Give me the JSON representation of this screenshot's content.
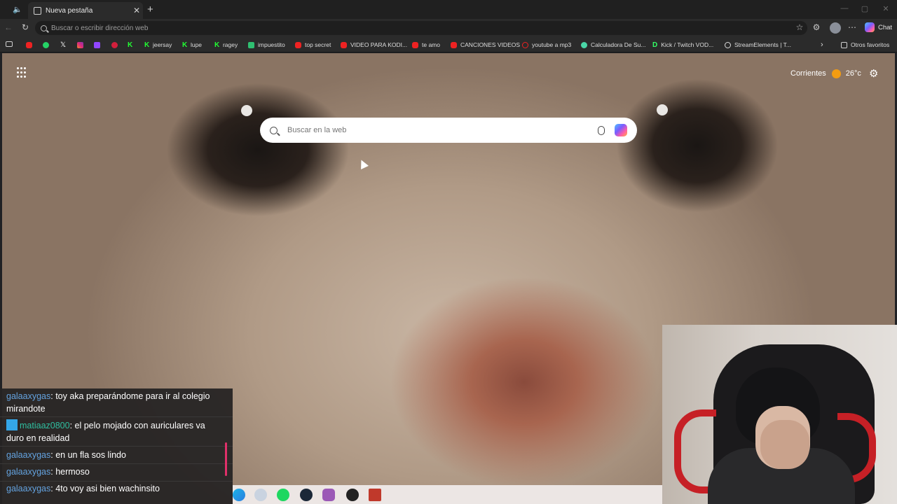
{
  "browser": {
    "tab_title": "Nueva pestaña",
    "address_placeholder": "Buscar o escribir dirección web",
    "chat_label": "Chat"
  },
  "bookmarks": [
    {
      "label": "",
      "icon": "youtube-icon"
    },
    {
      "label": "",
      "icon": "whatsapp-icon"
    },
    {
      "label": "",
      "icon": "x-icon"
    },
    {
      "label": "",
      "icon": "instagram-icon"
    },
    {
      "label": "",
      "icon": "twitch-icon"
    },
    {
      "label": "",
      "icon": "red-app-icon"
    },
    {
      "label": "",
      "icon": "kick-icon"
    },
    {
      "label": "jeersay",
      "icon": "kick-icon"
    },
    {
      "label": "lupe",
      "icon": "kick-icon"
    },
    {
      "label": "ragey",
      "icon": "kick-icon"
    },
    {
      "label": "impuestito",
      "icon": "sheet-icon"
    },
    {
      "label": "top secret",
      "icon": "youtube-icon"
    },
    {
      "label": "VIDEO PARA KODI...",
      "icon": "youtube-icon"
    },
    {
      "label": "te amo",
      "icon": "youtube-icon"
    },
    {
      "label": "CANCIONES VIDEOS",
      "icon": "youtube-icon"
    },
    {
      "label": "youtube a mp3",
      "icon": "converter-icon"
    },
    {
      "label": "Calculadora De Su...",
      "icon": "calculator-icon"
    },
    {
      "label": "Kick / Twitch VOD...",
      "icon": "d-icon"
    },
    {
      "label": "StreamElements | T...",
      "icon": "streamelements-icon"
    }
  ],
  "other_favorites": "Otros favoritos",
  "newtab": {
    "weather_city": "Corrientes",
    "weather_temp": "26°c",
    "search_placeholder": "Buscar en la web"
  },
  "chat": [
    {
      "user": "galaaxygas",
      "text": "toy aka preparándome para ir al colegio mirandote"
    },
    {
      "user": "matiaaz0800",
      "text": "el pelo mojado con auriculares va duro en realidad"
    },
    {
      "user": "galaaxygas",
      "text": "en un fla sos lindo"
    },
    {
      "user": "galaaxygas",
      "text": "hermoso"
    },
    {
      "user": "galaaxygas",
      "text": "4to voy asi bien wachinsito"
    }
  ],
  "colors": {
    "chat_username": "#64a3e0",
    "chat_badge": "#34a6e8",
    "weather_sun": "#f39c12"
  }
}
